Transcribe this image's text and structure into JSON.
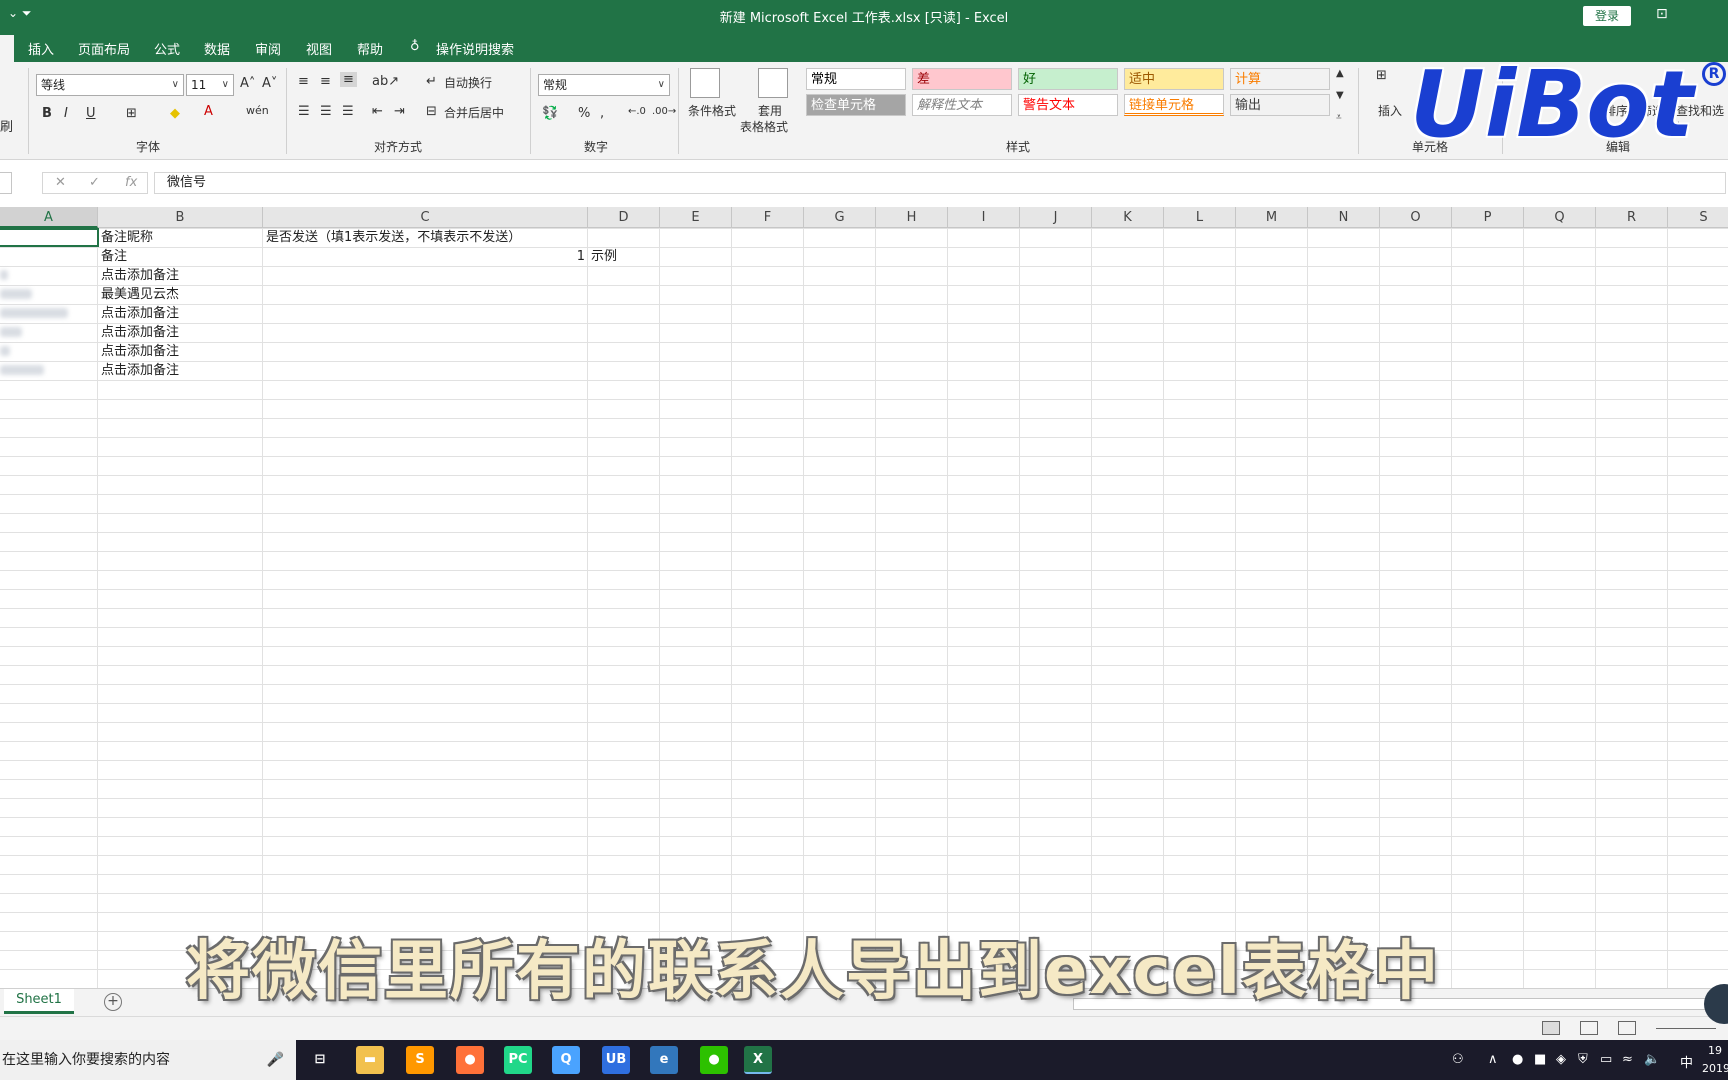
{
  "window": {
    "title": "新建 Microsoft Excel 工作表.xlsx  [只读]  -  Excel",
    "login_label": "登录"
  },
  "ribbon_tabs": [
    "插入",
    "页面布局",
    "公式",
    "数据",
    "审阅",
    "视图",
    "帮助"
  ],
  "tell_me": "操作说明搜索",
  "ribbon": {
    "clipboard_partial": "刷",
    "font": {
      "name": "等线",
      "size": "11",
      "bold": "B",
      "italic": "I",
      "underline": "U",
      "group_label": "字体"
    },
    "alignment": {
      "wrap_text": "自动换行",
      "merge_center": "合并后居中",
      "group_label": "对齐方式"
    },
    "number": {
      "format": "常规",
      "group_label": "数字"
    },
    "styles": {
      "conditional": "条件格式",
      "format_table_line1": "套用",
      "format_table_line2": "表格格式",
      "cells": [
        {
          "label": "常规",
          "bg": "#ffffff",
          "fg": "#000000"
        },
        {
          "label": "差",
          "bg": "#ffc7ce",
          "fg": "#9c0006"
        },
        {
          "label": "好",
          "bg": "#c6efce",
          "fg": "#006100"
        },
        {
          "label": "适中",
          "bg": "#ffeb9c",
          "fg": "#9c5700"
        },
        {
          "label": "计算",
          "bg": "#f2f2f2",
          "fg": "#fa7d00"
        },
        {
          "label": "检查单元格",
          "bg": "#a5a5a5",
          "fg": "#ffffff"
        },
        {
          "label": "解释性文本",
          "bg": "#ffffff",
          "fg": "#7f7f7f"
        },
        {
          "label": "警告文本",
          "bg": "#ffffff",
          "fg": "#ff0000"
        },
        {
          "label": "链接单元格",
          "bg": "#ffffff",
          "fg": "#fa7d00"
        },
        {
          "label": "输出",
          "bg": "#f2f2f2",
          "fg": "#3f3f3f"
        }
      ],
      "group_label": "样式"
    },
    "cells_group": {
      "insert": "插入",
      "group_label": "单元格"
    },
    "editing": {
      "sort_filter": "排序和筛选",
      "find_select": "查找和选择",
      "group_label": "编辑"
    }
  },
  "formula_bar": {
    "fx": "fx",
    "content": "微信号"
  },
  "columns": [
    "A",
    "B",
    "C",
    "D",
    "E",
    "F",
    "G",
    "H",
    "I",
    "J",
    "K",
    "L",
    "M",
    "N",
    "O",
    "P",
    "Q",
    "R",
    "S"
  ],
  "cells": {
    "B1": "备注昵称",
    "C1": "是否发送（填1表示发送，不填表示不发送）",
    "B2": "备注",
    "C2": "1",
    "D2": "示例",
    "B3": "点击添加备注",
    "B4": "最美遇见云杰",
    "B5": "点击添加备注",
    "B6": "点击添加备注",
    "B7": "点击添加备注",
    "B8": "点击添加备注"
  },
  "sheet_tabs": [
    "Sheet1"
  ],
  "taskbar": {
    "search_placeholder": "在这里输入你要搜索的内容",
    "apps": [
      {
        "name": "file-explorer",
        "glyph": "▬",
        "color": "#f2c14e"
      },
      {
        "name": "sublime",
        "glyph": "S",
        "color": "#ff9800"
      },
      {
        "name": "firefox",
        "glyph": "●",
        "color": "#ff7139"
      },
      {
        "name": "pycharm",
        "glyph": "PC",
        "color": "#21d789"
      },
      {
        "name": "qq-browser",
        "glyph": "Q",
        "color": "#4aa3ff"
      },
      {
        "name": "uibot",
        "glyph": "UB",
        "color": "#2f6fe0"
      },
      {
        "name": "edge",
        "glyph": "e",
        "color": "#3277bc"
      },
      {
        "name": "wechat",
        "glyph": "●",
        "color": "#2dc100"
      },
      {
        "name": "excel",
        "glyph": "X",
        "color": "#217346"
      }
    ],
    "ime": "中",
    "clock_partial": "19",
    "date_partial": "2019"
  },
  "overlay": {
    "subtitle": "将微信里所有的联系人导出到excel表格中",
    "logo": "UiBot",
    "logo_mark": "R"
  }
}
